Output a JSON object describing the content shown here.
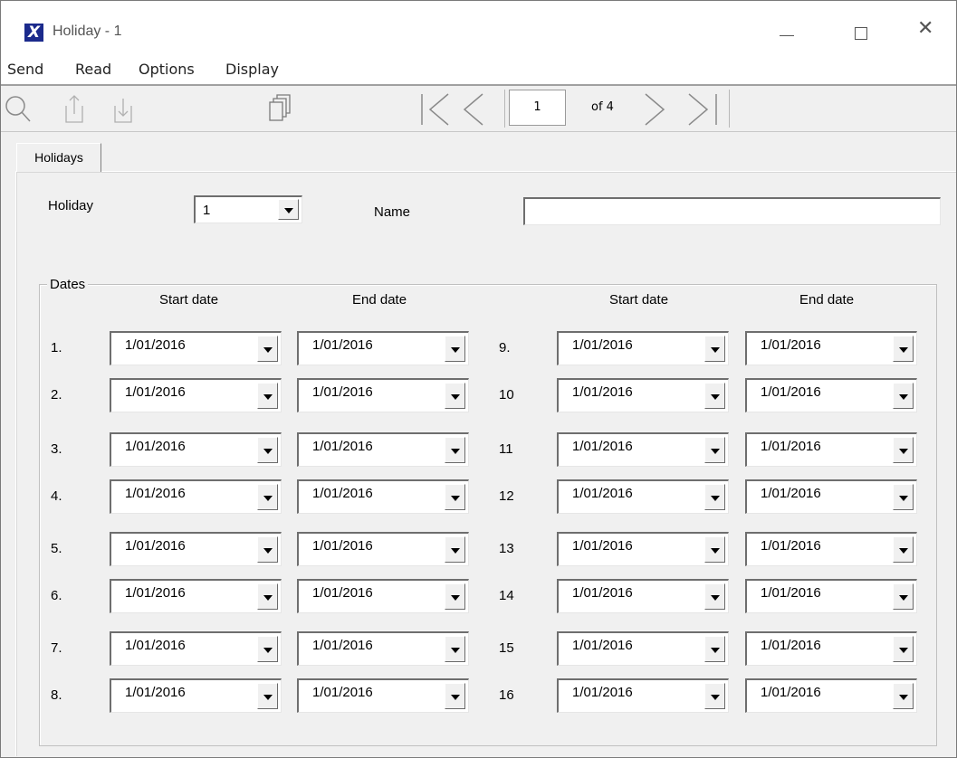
{
  "window": {
    "title": "Holiday - 1",
    "app_icon_glyph": "X",
    "controls": {
      "minimize": "minimize-icon",
      "maximize": "maximize-icon",
      "close": "✕"
    }
  },
  "menu": [
    "Send",
    "Read",
    "Options",
    "Display"
  ],
  "toolbar": {
    "icons": [
      "search-icon",
      "upload-icon",
      "download-icon",
      "copy-icon",
      "first-page-icon",
      "previous-page-icon",
      "next-page-icon",
      "last-page-icon"
    ],
    "page_current": "1",
    "page_total_label": "of 4"
  },
  "tab": {
    "label": "Holidays"
  },
  "form": {
    "holiday_label": "Holiday",
    "holiday_value": "1",
    "name_label": "Name",
    "name_value": ""
  },
  "dates": {
    "group_label": "Dates",
    "headers": {
      "start": "Start date",
      "end": "End date"
    },
    "left_rows": [
      {
        "num": "1.",
        "start": "1/01/2016",
        "end": "1/01/2016"
      },
      {
        "num": "2.",
        "start": "1/01/2016",
        "end": "1/01/2016"
      },
      {
        "num": "3.",
        "start": "1/01/2016",
        "end": "1/01/2016"
      },
      {
        "num": "4.",
        "start": "1/01/2016",
        "end": "1/01/2016"
      },
      {
        "num": "5.",
        "start": "1/01/2016",
        "end": "1/01/2016"
      },
      {
        "num": "6.",
        "start": "1/01/2016",
        "end": "1/01/2016"
      },
      {
        "num": "7.",
        "start": "1/01/2016",
        "end": "1/01/2016"
      },
      {
        "num": "8.",
        "start": "1/01/2016",
        "end": "1/01/2016"
      }
    ],
    "right_rows": [
      {
        "num": "9.",
        "start": "1/01/2016",
        "end": "1/01/2016"
      },
      {
        "num": "10",
        "start": "1/01/2016",
        "end": "1/01/2016"
      },
      {
        "num": "11",
        "start": "1/01/2016",
        "end": "1/01/2016"
      },
      {
        "num": "12",
        "start": "1/01/2016",
        "end": "1/01/2016"
      },
      {
        "num": "13",
        "start": "1/01/2016",
        "end": "1/01/2016"
      },
      {
        "num": "14",
        "start": "1/01/2016",
        "end": "1/01/2016"
      },
      {
        "num": "15",
        "start": "1/01/2016",
        "end": "1/01/2016"
      },
      {
        "num": "16",
        "start": "1/01/2016",
        "end": "1/01/2016"
      }
    ]
  }
}
